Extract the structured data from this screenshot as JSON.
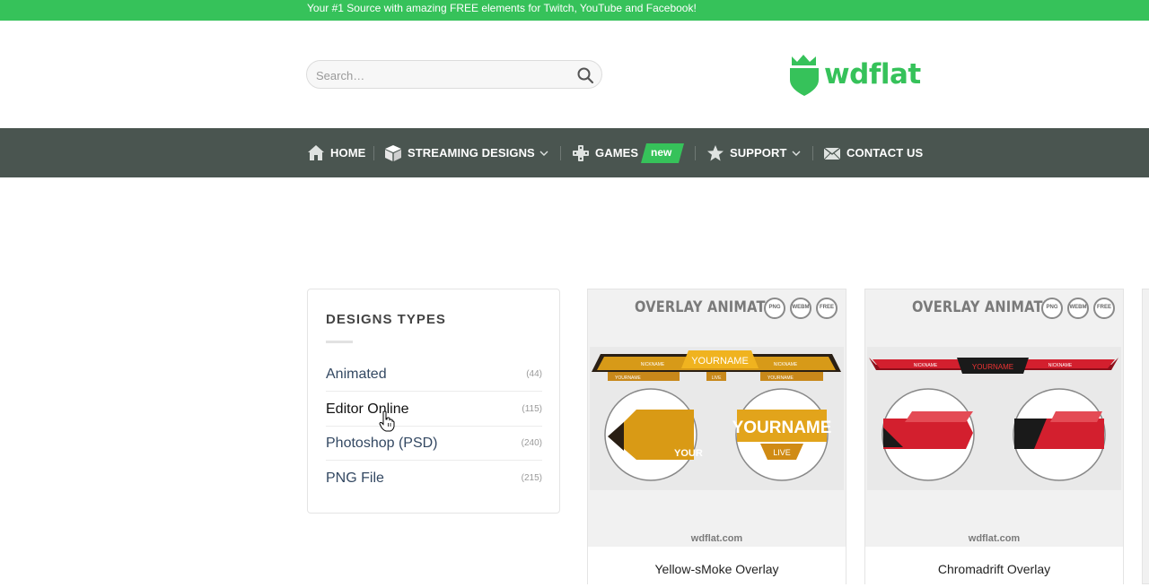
{
  "topbar": {
    "text": "Your #1 Source with amazing FREE elements for Twitch, YouTube and Facebook!"
  },
  "search": {
    "placeholder": "Search…"
  },
  "logo": {
    "text": "wdflat"
  },
  "nav": {
    "home": "HOME",
    "streaming": "STREAMING DESIGNS",
    "games": "GAMES",
    "games_badge": "new",
    "support": "SUPPORT",
    "contact": "CONTACT US"
  },
  "sidebar": {
    "title": "DESIGNS TYPES",
    "items": [
      {
        "label": "Animated",
        "count": "(44)"
      },
      {
        "label": "Editor Online",
        "count": "(115)"
      },
      {
        "label": "Photoshop (PSD)",
        "count": "(240)"
      },
      {
        "label": "PNG File",
        "count": "(215)"
      }
    ]
  },
  "products": [
    {
      "header": "OVERLAY ANIMATED",
      "credit": "wdflat.com",
      "title": "Yellow-sMoke Overlay",
      "banner_texts": [
        "NICKNAME",
        "YOURNAME",
        "NICKNAME",
        "YOURNAME",
        "LIVE",
        "YOURNAME"
      ],
      "cam_texts": [
        "YOUR",
        "YOURNAME",
        "LIVE"
      ]
    },
    {
      "header": "OVERLAY ANIMATED",
      "credit": "wdflat.com",
      "title": "Chromadrift Overlay",
      "banner_texts": [
        "NICKNAME",
        "YOURNAME",
        "NICKNAME"
      ]
    }
  ],
  "format_badges": [
    "PNG",
    "WEBM",
    "FREE"
  ],
  "colors": {
    "brand_green": "#36c25a",
    "nav_bg": "#4a5550",
    "link": "#334862"
  }
}
